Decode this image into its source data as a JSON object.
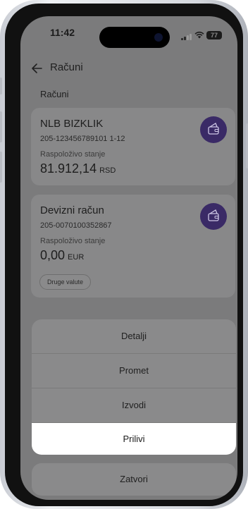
{
  "status_bar": {
    "time": "11:42",
    "battery": "77"
  },
  "nav": {
    "title": "Računi"
  },
  "section_title": "Računi",
  "accounts": [
    {
      "name": "NLB BIZKLIK",
      "iban": "205-123456789101 1-12",
      "balance_label": "Raspoloživo stanje",
      "amount": "81.912,14",
      "currency": "RSD"
    },
    {
      "name": "Devizni račun",
      "iban": "205-0070100352867",
      "balance_label": "Raspoloživo stanje",
      "amount": "0,00",
      "currency": "EUR",
      "extra_button": "Druge valute"
    }
  ],
  "action_sheet": {
    "items": [
      {
        "label": "Detalji",
        "selected": false
      },
      {
        "label": "Promet",
        "selected": false
      },
      {
        "label": "Izvodi",
        "selected": false
      },
      {
        "label": "Prilivi",
        "selected": true
      }
    ],
    "close_label": "Zatvori"
  },
  "colors": {
    "wallet_icon_bg": "#3a2a66",
    "overlay": "#7b7b7c",
    "selected_item": "#ffffff"
  }
}
